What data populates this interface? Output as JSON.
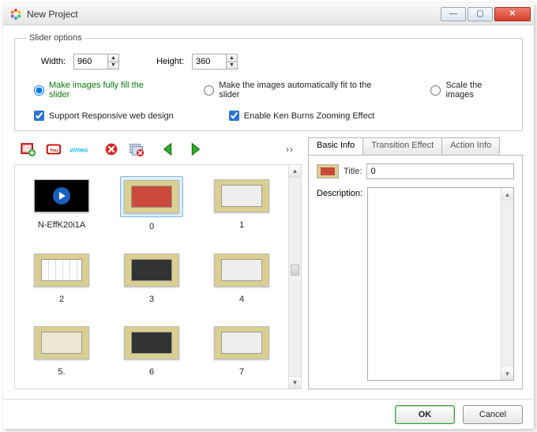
{
  "window": {
    "title": "New Project"
  },
  "slider_options": {
    "legend": "Slider options",
    "width_label": "Width:",
    "width_value": "960",
    "height_label": "Height:",
    "height_value": "360",
    "radios": {
      "fill": "Make images fully fill the slider",
      "fit": "Make the images automatically fit to the slider",
      "scale": "Scale the images"
    },
    "checks": {
      "responsive": "Support Responsive web design",
      "kenburns": "Enable Ken Burns Zooming Effect"
    }
  },
  "toolbar_overflow": "››",
  "thumbnails": [
    {
      "label": "N-EffK20i1A",
      "kind": "video",
      "selected": false
    },
    {
      "label": "0",
      "kind": "red",
      "selected": true
    },
    {
      "label": "1",
      "kind": "light",
      "selected": false
    },
    {
      "label": "2",
      "kind": "grid",
      "selected": false
    },
    {
      "label": "3",
      "kind": "dark",
      "selected": false
    },
    {
      "label": "4",
      "kind": "light",
      "selected": false
    },
    {
      "label": "5.",
      "kind": "photo",
      "selected": false
    },
    {
      "label": "6",
      "kind": "dark",
      "selected": false
    },
    {
      "label": "7",
      "kind": "light",
      "selected": false
    }
  ],
  "tabs": {
    "basic": "Basic Info",
    "transition": "Transition Effect",
    "action": "Action Info"
  },
  "basic_info": {
    "title_label": "Title:",
    "title_value": "0",
    "description_label": "Description:"
  },
  "footer": {
    "ok": "OK",
    "cancel": "Cancel"
  }
}
